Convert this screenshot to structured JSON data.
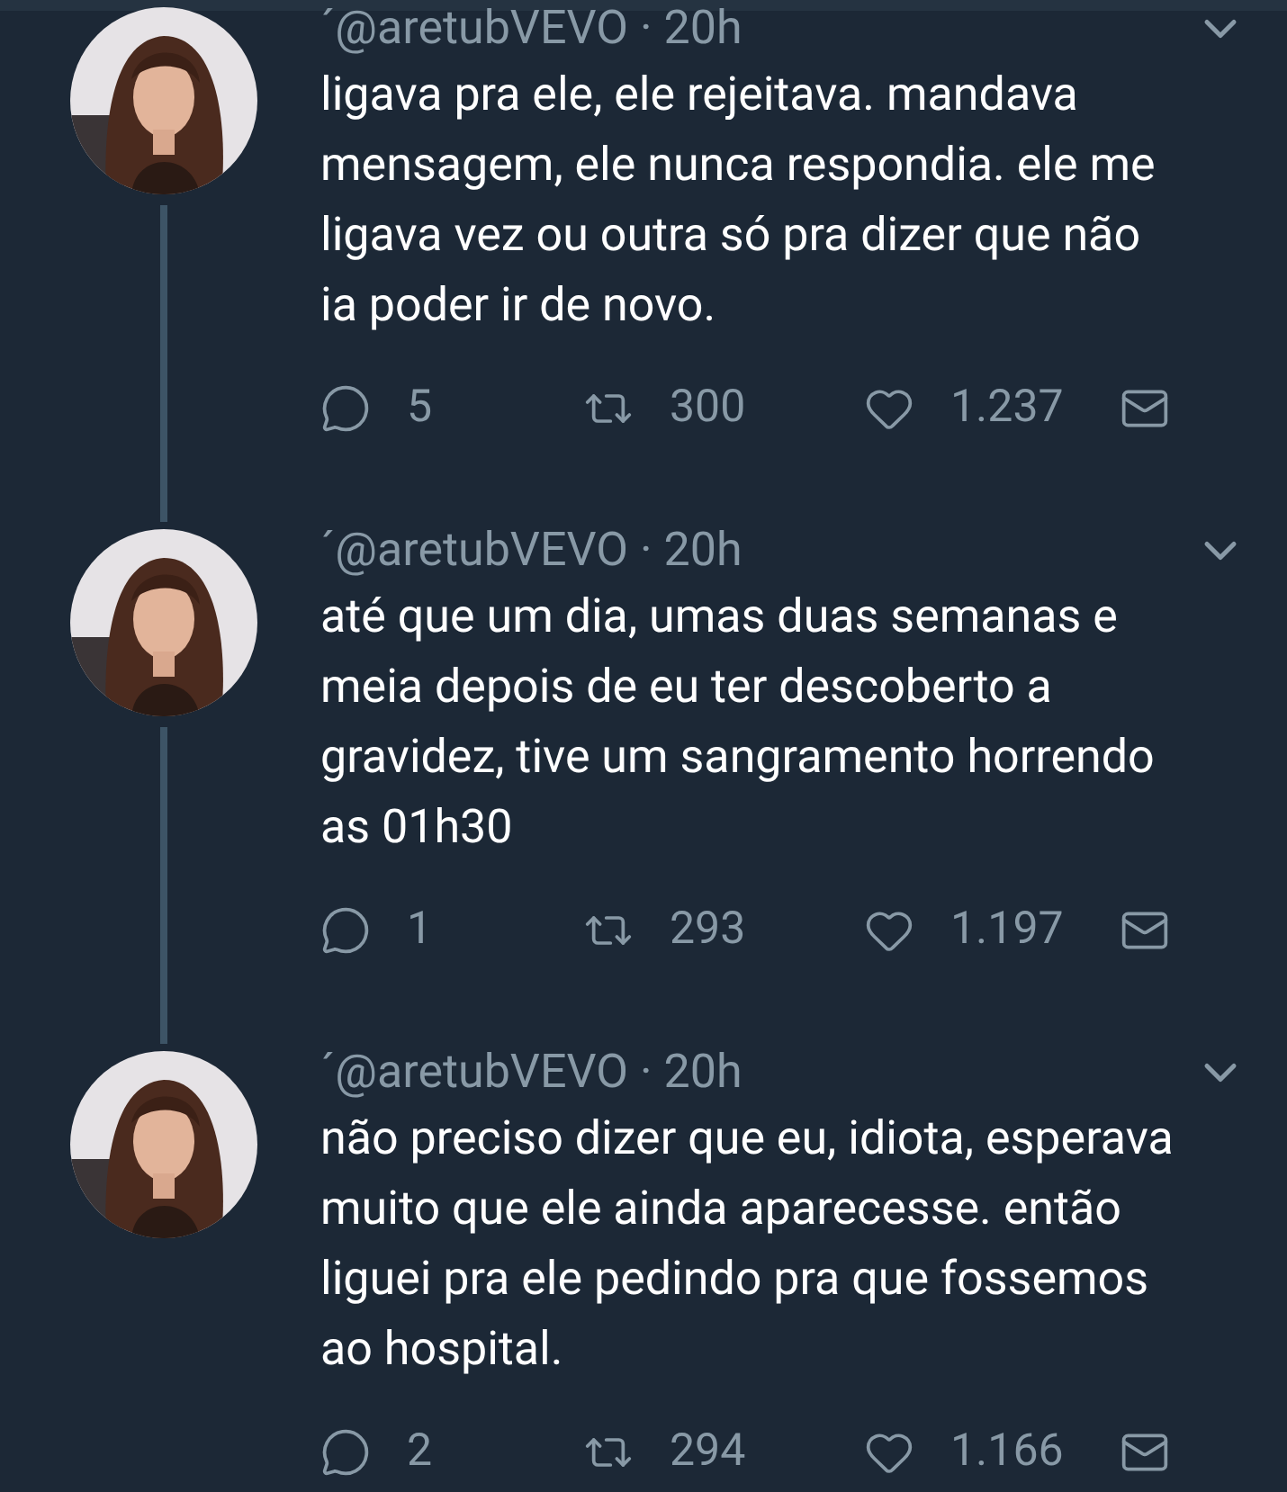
{
  "tweets": [
    {
      "byline": "´@aretubVEVO · 20h",
      "lines": [
        "ligava pra ele, ele rejeitava. mandava",
        "mensagem, ele nunca respondia. ele me",
        "ligava vez ou outra só pra dizer que não",
        "ia poder ir de novo."
      ],
      "replies": "5",
      "retweets": "300",
      "likes": "1.237",
      "thread_continues": true
    },
    {
      "byline": "´@aretubVEVO · 20h",
      "lines": [
        "até que um dia, umas duas semanas e",
        "meia depois de eu ter descoberto a",
        "gravidez, tive um sangramento horrendo",
        "as 01h30"
      ],
      "replies": "1",
      "retweets": "293",
      "likes": "1.197",
      "thread_continues": true
    },
    {
      "byline": "´@aretubVEVO · 20h",
      "lines": [
        "não preciso dizer que eu, idiota, esperava",
        "muito que ele ainda aparecesse. então",
        "liguei pra ele pedindo pra que fossemos",
        "ao hospital."
      ],
      "replies": "2",
      "retweets": "294",
      "likes": "1.166",
      "thread_continues": false
    }
  ]
}
